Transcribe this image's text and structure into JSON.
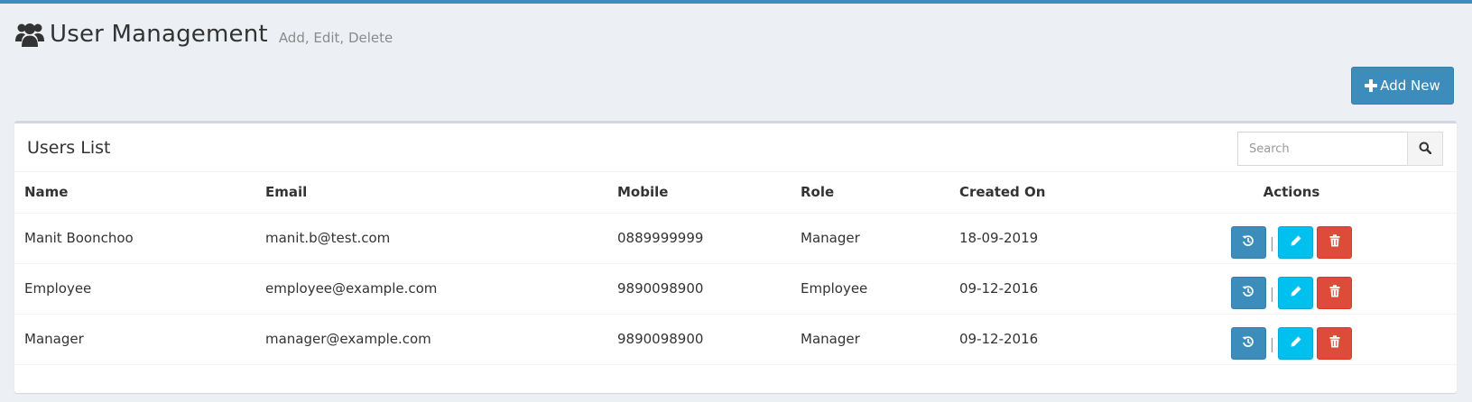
{
  "header": {
    "title": "User Management",
    "subtitle": "Add, Edit, Delete",
    "add_new_label": "Add New"
  },
  "box": {
    "title": "Users List",
    "search_placeholder": "Search"
  },
  "table": {
    "columns": [
      "Name",
      "Email",
      "Mobile",
      "Role",
      "Created On",
      "Actions"
    ],
    "rows": [
      {
        "name": "Manit Boonchoo",
        "email": "manit.b@test.com",
        "mobile": "0889999999",
        "role": "Manager",
        "created_on": "18-09-2019"
      },
      {
        "name": "Employee",
        "email": "employee@example.com",
        "mobile": "9890098900",
        "role": "Employee",
        "created_on": "09-12-2016"
      },
      {
        "name": "Manager",
        "email": "manager@example.com",
        "mobile": "9890098900",
        "role": "Manager",
        "created_on": "09-12-2016"
      }
    ],
    "row_actions": [
      "history-icon",
      "pencil-icon",
      "trash-icon"
    ],
    "separator": "|"
  },
  "colors": {
    "primary": "#3c8dbc",
    "info": "#00c0ef",
    "danger": "#dd4b39",
    "background": "#ecf0f5"
  }
}
